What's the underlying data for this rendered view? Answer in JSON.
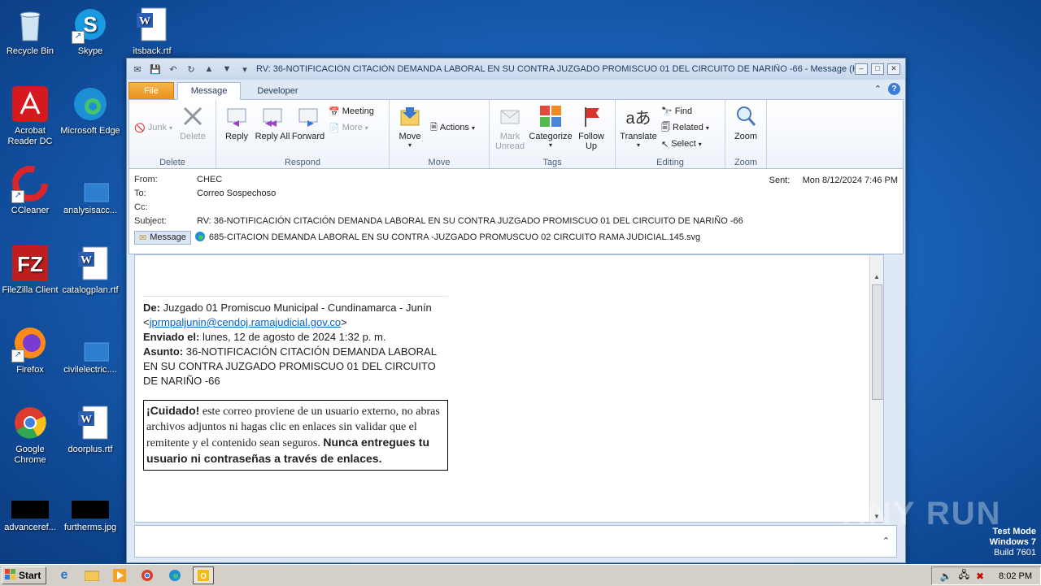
{
  "desktop": {
    "icons": [
      {
        "label": "Recycle Bin"
      },
      {
        "label": "Skype"
      },
      {
        "label": "itsback.rtf"
      },
      {
        "label": "Acrobat Reader DC"
      },
      {
        "label": "Microsoft Edge"
      },
      {
        "label": "CCleaner"
      },
      {
        "label": "analysisacc..."
      },
      {
        "label": "FileZilla Client"
      },
      {
        "label": "catalogplan.rtf"
      },
      {
        "label": "Firefox"
      },
      {
        "label": "civilelectric...."
      },
      {
        "label": "Google Chrome"
      },
      {
        "label": "doorplus.rtf"
      },
      {
        "label": "advanceref..."
      },
      {
        "label": "furtherms.jpg"
      }
    ]
  },
  "window": {
    "title": "RV: 36-NOTIFICACIÓN CITACIÓN DEMANDA LABORAL EN SU CONTRA JUZGADO PROMISCUO 01 DEL CIRCUITO DE NARIÑO -66  -  Message (H...",
    "tabs": [
      "File",
      "Message",
      "Developer"
    ],
    "ribbon": {
      "junk": "Junk",
      "delete": "Delete",
      "group_delete": "Delete",
      "reply": "Reply",
      "reply_all": "Reply All",
      "forward": "Forward",
      "meeting": "Meeting",
      "more": "More",
      "group_respond": "Respond",
      "move": "Move",
      "actions": "Actions",
      "group_move": "Move",
      "mark_unread": "Mark Unread",
      "categorize": "Categorize",
      "follow_up": "Follow Up",
      "group_tags": "Tags",
      "translate": "Translate",
      "find": "Find",
      "related": "Related",
      "select": "Select",
      "group_editing": "Editing",
      "zoom": "Zoom",
      "group_zoom": "Zoom"
    },
    "header": {
      "from_label": "From:",
      "from": "CHEC",
      "to_label": "To:",
      "to": "Correo Sospechoso",
      "cc_label": "Cc:",
      "cc": "",
      "subject_label": "Subject:",
      "subject": "RV: 36-NOTIFICACIÓN CITACIÓN DEMANDA LABORAL EN SU CONTRA JUZGADO PROMISCUO 01 DEL CIRCUITO DE NARIÑO -66",
      "sent_label": "Sent:",
      "sent": "Mon 8/12/2024 7:46 PM",
      "message_chip": "Message",
      "attachment": "685-CITACION DEMANDA LABORAL EN SU CONTRA -JUZGADO  PROMUSCUO  02  CIRCUITO  RAMA JUDICIAL.145.svg"
    },
    "body": {
      "de_label": "De:",
      "de": " Juzgado 01 Promiscuo Municipal - Cundinamarca - Junín",
      "email_open": "<",
      "email": "jprmpaljunin@cendoj.ramajudicial.gov.co",
      "email_close": ">",
      "enviado_label": "Enviado el:",
      "enviado": " lunes, 12 de agosto de 2024 1:32 p. m.",
      "asunto_label": "Asunto:",
      "asunto": " 36-NOTIFICACIÓN CITACIÓN DEMANDA LABORAL EN SU CONTRA JUZGADO PROMISCUO 01 DEL CIRCUITO DE NARIÑO -66",
      "warn_bold": "¡Cuidado!",
      "warn_text": " este correo proviene de un usuario externo, no abras archivos adjuntos ni hagas clic en enlaces sin validar que el remitente y el contenido sean seguros. ",
      "warn_bold2": "Nunca entregues tu usuario ni contraseñas a través de enlaces."
    }
  },
  "taskbar": {
    "start": "Start",
    "clock": "8:02 PM"
  },
  "overlay": {
    "test_mode": "Test Mode",
    "windows": "Windows 7",
    "build": "Build 7601",
    "watermark": "ANY RUN"
  }
}
